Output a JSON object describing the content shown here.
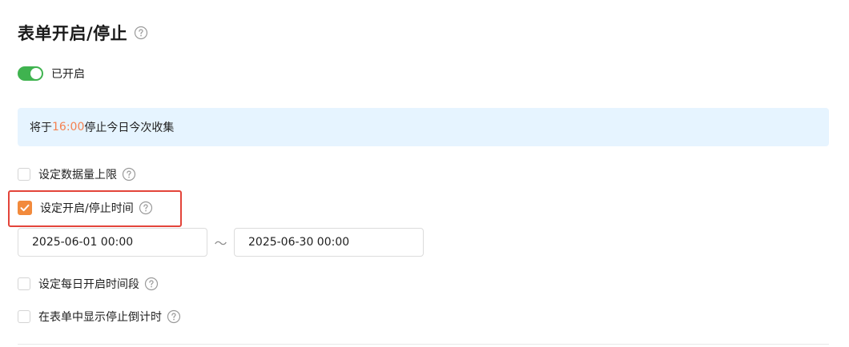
{
  "section": {
    "title": "表单开启/停止",
    "title_help_icon": "question-circle-icon"
  },
  "status_switch": {
    "on": true,
    "label": "已开启",
    "color": "#3fb34f"
  },
  "info_banner": {
    "prefix": "将于",
    "time": "16:00",
    "suffix": "停止今日今次收集",
    "background": "#e6f4ff",
    "highlight_color": "#f5814f"
  },
  "options": [
    {
      "label": "设定数据量上限",
      "checked": false
    },
    {
      "label": "设定开启/停止时间",
      "checked": true
    },
    {
      "label": "设定每日开启时间段",
      "checked": false
    },
    {
      "label": "在表单中显示停止倒计时",
      "checked": false
    }
  ],
  "date_range": {
    "start": "2025-06-01 00:00",
    "separator": "～",
    "end": "2025-06-30 00:00"
  },
  "colors": {
    "checkbox_checked": "#f28a3c",
    "highlight_border": "#e3443a"
  }
}
